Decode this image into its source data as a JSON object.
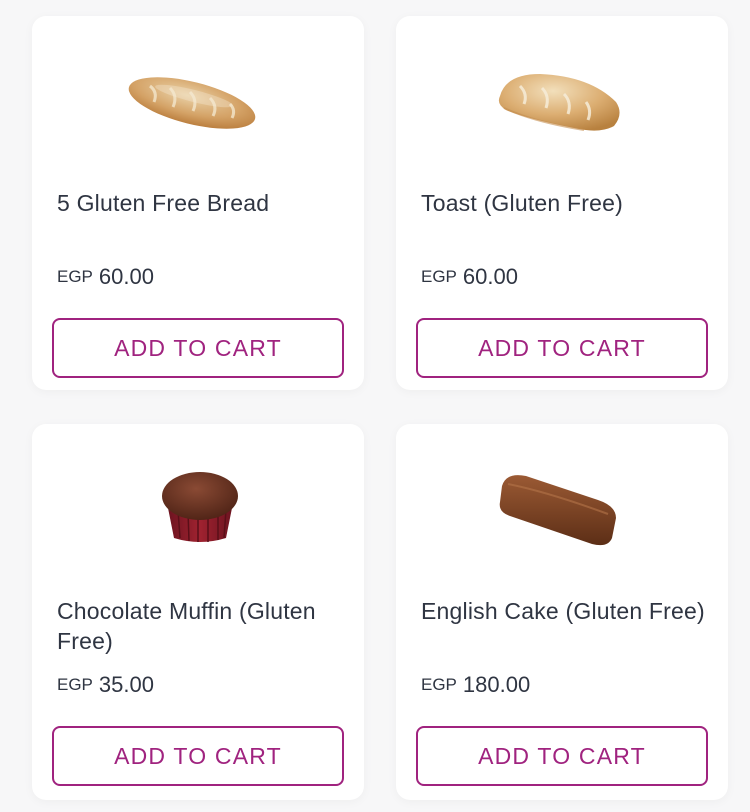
{
  "products": [
    {
      "name": "5 Gluten Free Bread",
      "currency": "EGP",
      "price": "60.00",
      "button": "ADD TO CART",
      "image": "bread-loaf"
    },
    {
      "name": "Toast (Gluten Free)",
      "currency": "EGP",
      "price": "60.00",
      "button": "ADD TO CART",
      "image": "toast-loaf"
    },
    {
      "name": "Chocolate Muffin (Gluten Free)",
      "currency": "EGP",
      "price": "35.00",
      "button": "ADD TO CART",
      "image": "chocolate-muffin"
    },
    {
      "name": "English Cake (Gluten Free)",
      "currency": "EGP",
      "price": "180.00",
      "button": "ADD TO CART",
      "image": "english-cake"
    }
  ],
  "colors": {
    "accent": "#a0237f",
    "text": "#2f3542",
    "card": "#ffffff",
    "background": "#f7f7f8"
  }
}
